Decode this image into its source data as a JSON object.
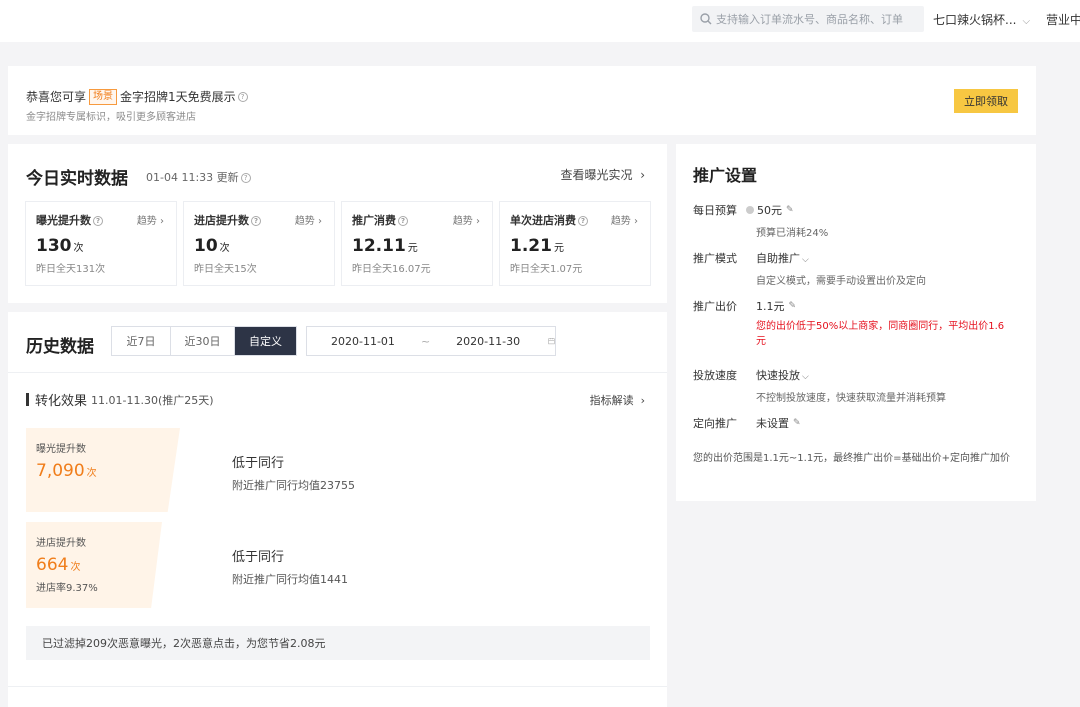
{
  "header": {
    "search_placeholder": "支持输入订单流水号、商品名称、订单",
    "store_name": "七口辣火锅杯...",
    "business_status": "营业中"
  },
  "banner": {
    "prefix": "恭喜您可享",
    "tag": "场景",
    "title": "金字招牌1天免费展示",
    "subtitle": "金字招牌专属标识，吸引更多顾客进店",
    "button": "立即领取"
  },
  "today": {
    "title": "今日实时数据",
    "updated": "01-04 11:33 更新",
    "view_link": "查看曝光实况",
    "metrics": [
      {
        "title": "曝光提升数",
        "trend": "趋势",
        "value": "130",
        "unit": "次",
        "yesterday": "昨日全天131次"
      },
      {
        "title": "进店提升数",
        "trend": "趋势",
        "value": "10",
        "unit": "次",
        "yesterday": "昨日全天15次"
      },
      {
        "title": "推广消费",
        "trend": "趋势",
        "value": "12.11",
        "unit": "元",
        "yesterday": "昨日全天16.07元"
      },
      {
        "title": "单次进店消费",
        "trend": "趋势",
        "value": "1.21",
        "unit": "元",
        "yesterday": "昨日全天1.07元"
      }
    ]
  },
  "history": {
    "title": "历史数据",
    "tabs": [
      "近7日",
      "近30日",
      "自定义"
    ],
    "start_date": "2020-11-01",
    "tilde": "~",
    "end_date": "2020-11-30",
    "conversion_title": "转化效果",
    "conversion_range": "11.01-11.30(推广25天)",
    "metric_link": "指标解读",
    "funnel": [
      {
        "title": "曝光提升数",
        "value": "7,090",
        "unit": "次",
        "rate": "",
        "compare": "低于同行",
        "compare_detail": "附近推广同行均值23755"
      },
      {
        "title": "进店提升数",
        "value": "664",
        "unit": "次",
        "rate": "进店率9.37%",
        "compare": "低于同行",
        "compare_detail": "附近推广同行均值1441"
      }
    ],
    "filter_note": "已过滤掉209次恶意曝光，2次恶意点击，为您节省2.08元"
  },
  "settings": {
    "title": "推广设置",
    "budget_label": "每日预算",
    "budget_value": "50元",
    "budget_note": "预算已消耗24%",
    "mode_label": "推广模式",
    "mode_value": "自助推广",
    "mode_note": "自定义模式，需要手动设置出价及定向",
    "bid_label": "推广出价",
    "bid_value": "1.1元",
    "bid_warning": "您的出价低于50%以上商家，同商圈同行，平均出价1.6元",
    "speed_label": "投放速度",
    "speed_value": "快速投放",
    "speed_note": "不控制投放速度，快速获取流量并消耗预算",
    "target_label": "定向推广",
    "target_value": "未设置",
    "footer": "您的出价范围是1.1元~1.1元，最终推广出价=基础出价+定向推广加价"
  }
}
